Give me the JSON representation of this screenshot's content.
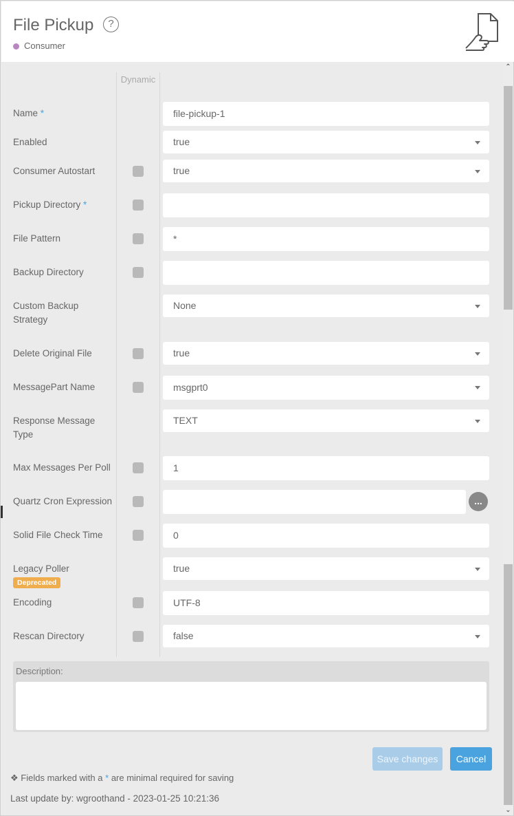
{
  "header": {
    "title": "File Pickup",
    "help_glyph": "?",
    "subtitle": "Consumer",
    "icon": "hand-file-icon"
  },
  "form": {
    "dynamic_header": "Dynamic",
    "fields": [
      {
        "label": "Name",
        "required": true,
        "dynamic_checkbox": false,
        "control": "text",
        "value": "file-pickup-1"
      },
      {
        "label": "Enabled",
        "required": false,
        "dynamic_checkbox": false,
        "control": "select",
        "value": "true"
      },
      {
        "label": "Consumer Autostart",
        "required": false,
        "dynamic_checkbox": true,
        "control": "select",
        "value": "true"
      },
      {
        "label": "Pickup Directory",
        "required": true,
        "dynamic_checkbox": true,
        "control": "text",
        "value": ""
      },
      {
        "label": "File Pattern",
        "required": false,
        "dynamic_checkbox": true,
        "control": "text",
        "value": "*"
      },
      {
        "label": "Backup Directory",
        "required": false,
        "dynamic_checkbox": true,
        "control": "text",
        "value": ""
      },
      {
        "label": "Custom Backup Strategy",
        "required": false,
        "dynamic_checkbox": false,
        "control": "select",
        "value": "None"
      },
      {
        "label": "Delete Original File",
        "required": false,
        "dynamic_checkbox": true,
        "control": "select",
        "value": "true"
      },
      {
        "label": "MessagePart Name",
        "required": false,
        "dynamic_checkbox": true,
        "control": "select",
        "value": "msgprt0"
      },
      {
        "label": "Response Message Type",
        "required": false,
        "dynamic_checkbox": false,
        "control": "select",
        "value": "TEXT"
      },
      {
        "label": "Max Messages Per Poll",
        "required": false,
        "dynamic_checkbox": true,
        "control": "text",
        "value": "1"
      },
      {
        "label": "Quartz Cron Expression",
        "required": false,
        "dynamic_checkbox": true,
        "control": "text",
        "value": "",
        "button_glyph": "..."
      },
      {
        "label": "Solid File Check Time",
        "required": false,
        "dynamic_checkbox": true,
        "control": "text",
        "value": "0"
      },
      {
        "label": "Legacy Poller",
        "required": false,
        "dynamic_checkbox": false,
        "control": "select",
        "value": "true",
        "badge": "Deprecated"
      },
      {
        "label": "Encoding",
        "required": false,
        "dynamic_checkbox": true,
        "control": "text",
        "value": "UTF-8"
      },
      {
        "label": "Rescan Directory",
        "required": false,
        "dynamic_checkbox": true,
        "control": "select",
        "value": "false"
      }
    ],
    "required_marker": "*",
    "description_label": "Description:",
    "description_value": ""
  },
  "buttons": {
    "save": "Save changes",
    "cancel": "Cancel"
  },
  "footer": {
    "note_prefix": "Fields marked with a",
    "note_marker": "*",
    "note_suffix": "are minimal required for saving",
    "last_update": "Last update by: wgroothand - 2023-01-25 10:21:36"
  },
  "colors": {
    "accent": "#4aa3df",
    "consumer_dot": "#b887c0",
    "deprecated_badge": "#f0ad4e",
    "save_disabled": "#a9cde9"
  }
}
